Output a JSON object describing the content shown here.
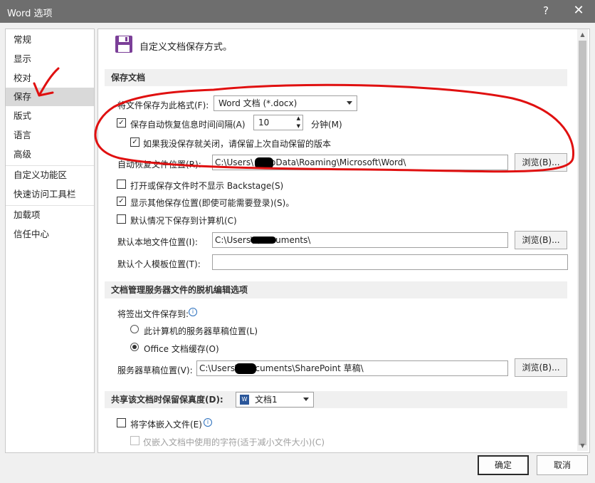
{
  "window": {
    "title": "Word 选项",
    "help": "?",
    "close": "✕"
  },
  "nav": {
    "items": [
      {
        "label": "常规"
      },
      {
        "label": "显示"
      },
      {
        "label": "校对"
      },
      {
        "label": "保存"
      },
      {
        "label": "版式"
      },
      {
        "label": "语言"
      },
      {
        "label": "高级"
      },
      {
        "label": "自定义功能区"
      },
      {
        "label": "快速访问工具栏"
      },
      {
        "label": "加载项"
      },
      {
        "label": "信任中心"
      }
    ],
    "selected": "保存"
  },
  "header": {
    "icon": "save-icon",
    "title": "自定义文档保存方式。"
  },
  "save_section": {
    "header": "保存文档",
    "format_label": "将文件保存为此格式(F):",
    "format_value": "Word 文档 (*.docx)",
    "autorecover_label": "保存自动恢复信息时间间隔(A)",
    "autorecover_checked": true,
    "autorecover_minutes": "10",
    "minutes_unit": "分钟(M)",
    "keep_last_label": "如果我没保存就关闭，请保留上次自动保留的版本",
    "keep_last_checked": true,
    "autorecover_path_label": "自动恢复文件位置(R):",
    "autorecover_path_value": "C:\\Users\\     \\AppData\\Roaming\\Microsoft\\Word\\",
    "browse": "浏览(B)...",
    "no_backstage_label": "打开或保存文件时不显示 Backstage(S)",
    "no_backstage_checked": false,
    "show_more_label": "显示其他保存位置(即使可能需要登录)(S)。",
    "show_more_checked": true,
    "default_computer_label": "默认情况下保存到计算机(C)",
    "default_computer_checked": false,
    "local_path_label": "默认本地文件位置(I):",
    "local_path_value": "C:\\Users\\      \\Documents\\",
    "template_path_label": "默认个人模板位置(T):",
    "template_path_value": ""
  },
  "offline_section": {
    "header": "文档管理服务器文件的脱机编辑选项",
    "checkout_label": "将签出文件保存到:",
    "info_icon": "info-icon",
    "option1": "此计算机的服务器草稿位置(L)",
    "option2": "Office 文档缓存(O)",
    "selected_option": "Office 文档缓存(O)",
    "drafts_label": "服务器草稿位置(V):",
    "drafts_value": "C:\\Users\\      \\Documents\\SharePoint 草稿\\",
    "browse": "浏览(B)..."
  },
  "share_section": {
    "header": "共享该文档时保留保真度(D):",
    "doc_value": "文档1",
    "embed_fonts_label": "将字体嵌入文件(E)",
    "embed_fonts_checked": false,
    "embed_used_label": "仅嵌入文档中使用的字符(适于减小文件大小)(C)"
  },
  "footer": {
    "ok": "确定",
    "cancel": "取消"
  },
  "colors": {
    "titlebar": "#6e6e6e",
    "nav_selected": "#d9d9d9",
    "annotation": "#e01010",
    "save_icon": "#7b3f98"
  }
}
